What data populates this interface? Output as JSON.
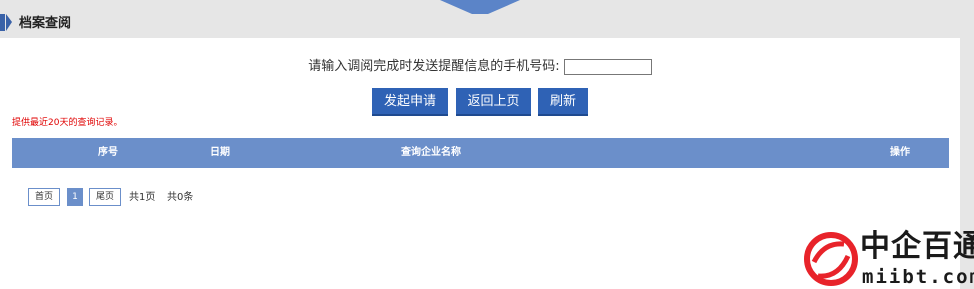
{
  "header": {
    "title": "档案查阅"
  },
  "form": {
    "phone_label": "请输入调阅完成时发送提醒信息的手机号码:",
    "phone_value": ""
  },
  "buttons": {
    "submit": "发起申请",
    "back": "返回上页",
    "refresh": "刷新"
  },
  "notice": "提供最近20天的查询记录。",
  "table": {
    "columns": [
      "序号",
      "日期",
      "查询企业名称",
      "操作"
    ],
    "rows": []
  },
  "pager": {
    "first": "首页",
    "current_page": "1",
    "last": "尾页",
    "total_pages": "共1页",
    "total_records": "共0条"
  },
  "watermark": {
    "title": "中企百通",
    "domain": "miibt.com"
  },
  "colors": {
    "accent": "#2f62b5",
    "table_header": "#6b8fca",
    "notice": "#e00000"
  }
}
